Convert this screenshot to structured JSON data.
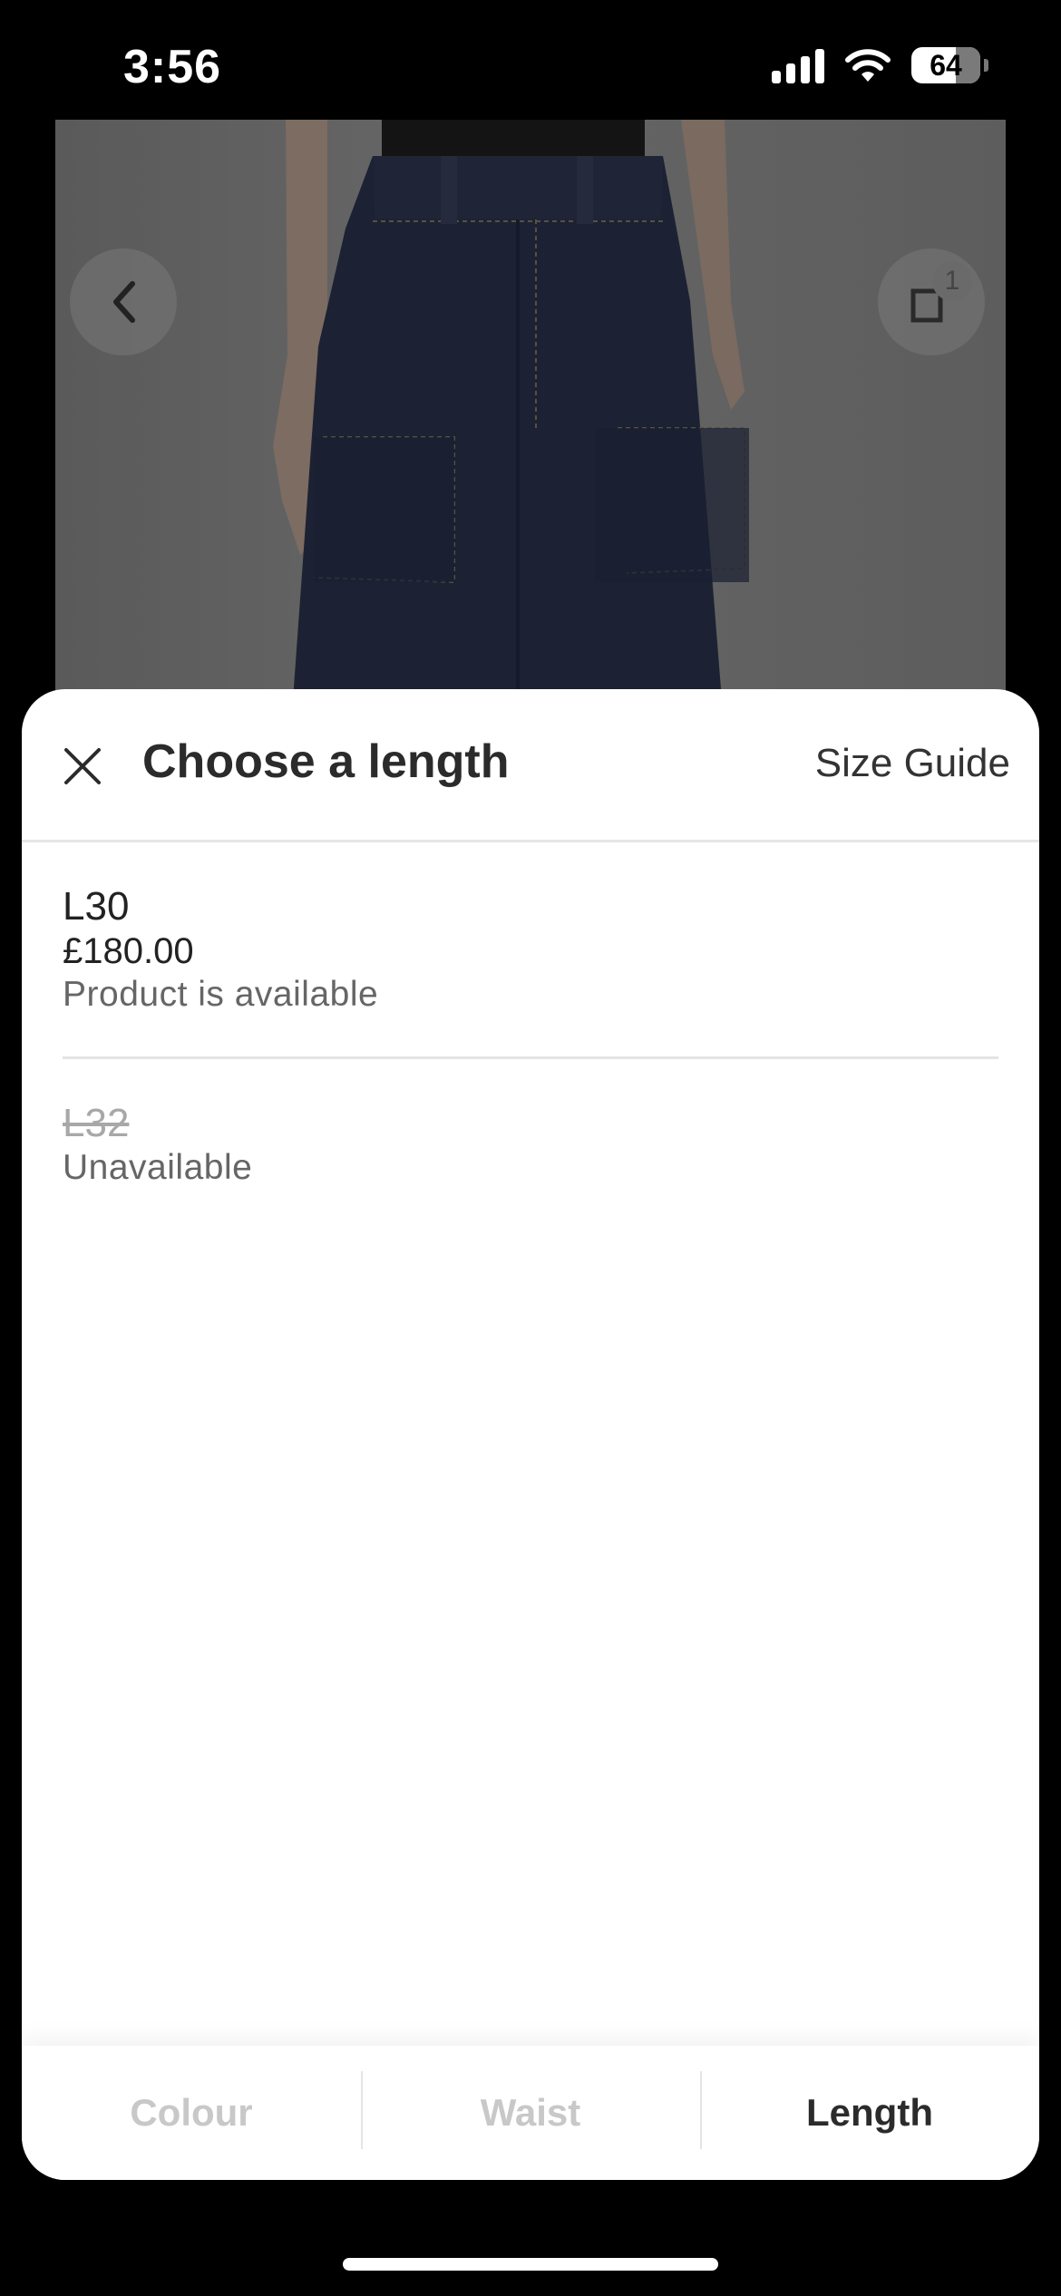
{
  "status_bar": {
    "time": "3:56",
    "battery": "64"
  },
  "product": {
    "share_count": "1"
  },
  "sheet": {
    "title": "Choose a length",
    "size_guide_label": "Size Guide",
    "options": [
      {
        "name": "L30",
        "price": "£180.00",
        "status": "Product is available",
        "available": true
      },
      {
        "name": "L32",
        "status": "Unavailable",
        "available": false
      }
    ]
  },
  "tabs": [
    {
      "label": "Colour",
      "active": false
    },
    {
      "label": "Waist",
      "active": false
    },
    {
      "label": "Length",
      "active": true
    }
  ],
  "colors": {
    "text_primary": "#2b2b2b",
    "text_muted": "#666666",
    "tab_inactive": "#c8c8c8",
    "overlay_dim": "#000000"
  }
}
